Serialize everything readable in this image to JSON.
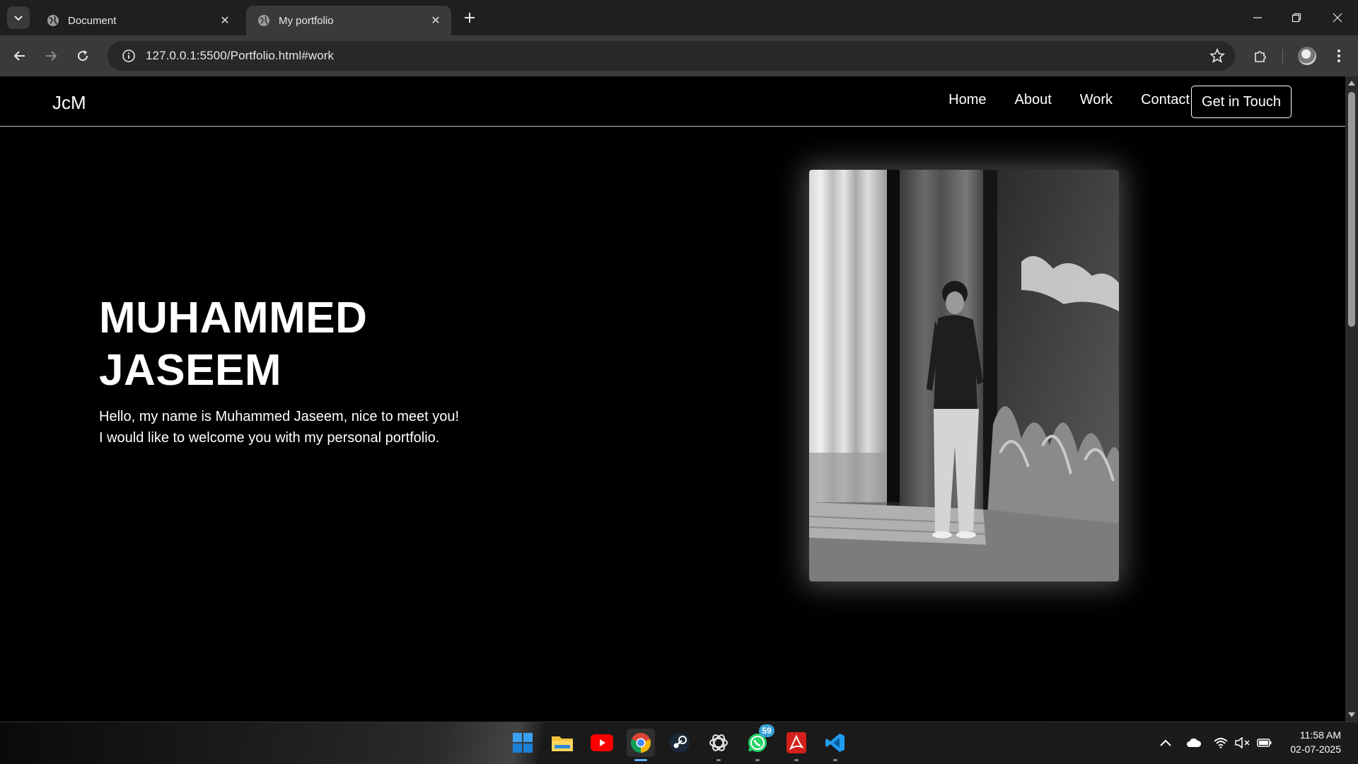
{
  "browser": {
    "tabs": [
      {
        "title": "Document",
        "active": false
      },
      {
        "title": "My portfolio",
        "active": true
      }
    ],
    "url": "127.0.0.1:5500/Portfolio.html#work"
  },
  "site": {
    "logo": "JcM",
    "nav": [
      "Home",
      "About",
      "Work",
      "Contact"
    ],
    "cta": "Get in Touch",
    "hero": {
      "name_line1": "MUHAMMED",
      "name_line2": "JASEEM",
      "intro_line1": "Hello, my name is Muhammed Jaseem, nice to meet you!",
      "intro_line2": "I would like to welcome you with my personal portfolio."
    }
  },
  "taskbar": {
    "apps": [
      "windows-start",
      "file-explorer",
      "youtube",
      "chrome",
      "steam",
      "chatgpt",
      "whatsapp",
      "acrobat",
      "vscode"
    ],
    "whatsapp_badge": "59",
    "time": "11:58 AM",
    "date": "02-07-2025"
  },
  "colors": {
    "page_bg": "#000000",
    "chrome_tabbar": "#1f1f1f",
    "chrome_toolbar": "#3a3a3a",
    "accent": "#5fb3ff"
  }
}
